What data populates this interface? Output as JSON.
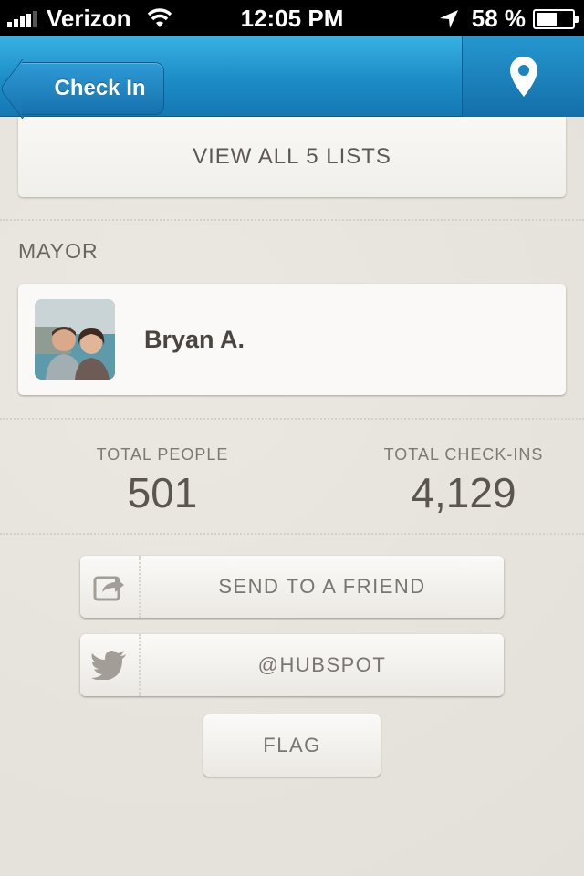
{
  "status_bar": {
    "carrier": "Verizon",
    "time": "12:05 PM",
    "battery": "58 %",
    "battery_level": 0.58
  },
  "nav": {
    "back_label": "Check In",
    "map_icon": "location-pin-icon"
  },
  "lists": {
    "view_all_label": "VIEW ALL 5 LISTS"
  },
  "mayor": {
    "section_label": "MAYOR",
    "name": "Bryan A."
  },
  "stats": {
    "people_label": "TOTAL PEOPLE",
    "people_value": "501",
    "checkins_label": "TOTAL CHECK-INS",
    "checkins_value": "4,129"
  },
  "actions": {
    "send_label": "SEND TO A FRIEND",
    "twitter_label": "@HUBSPOT",
    "flag_label": "FLAG"
  },
  "colors": {
    "nav_blue": "#1c8cc6",
    "background": "#e8e5df",
    "text_gray": "#6a655f"
  }
}
